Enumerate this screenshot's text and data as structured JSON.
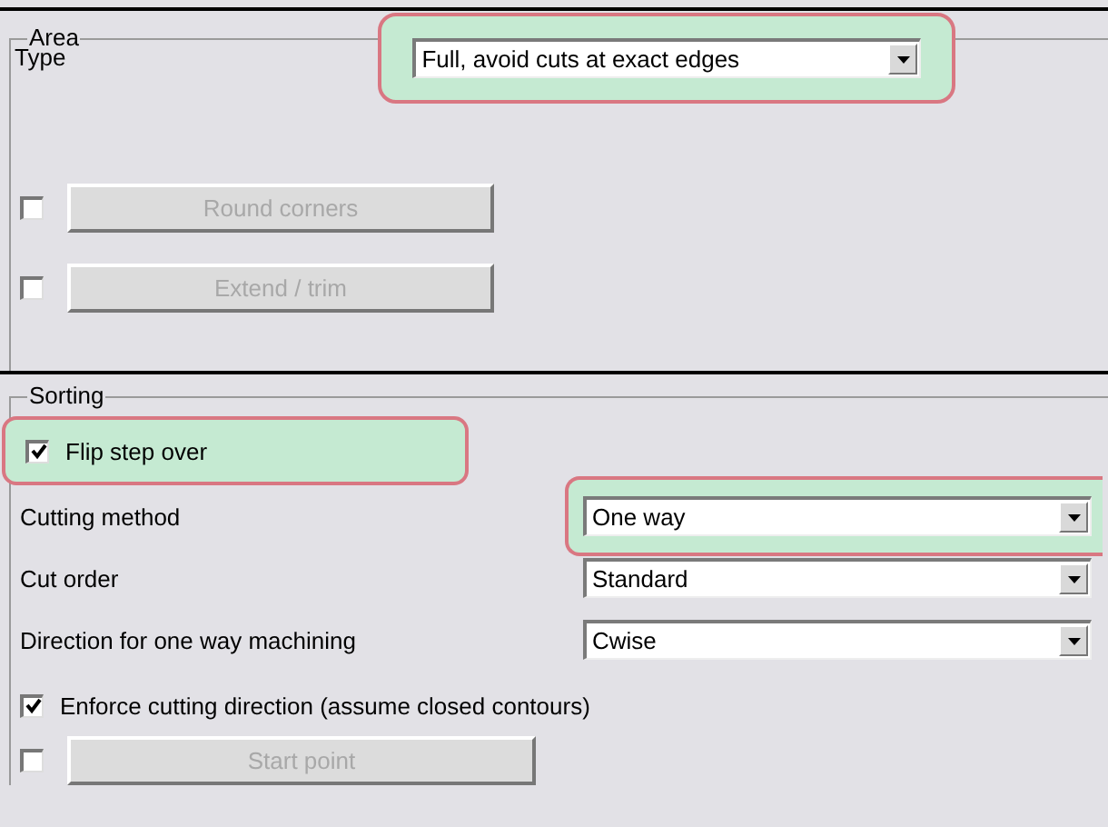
{
  "area": {
    "title": "Area",
    "type_label": "Type",
    "type_select": {
      "value": "Full, avoid cuts at exact edges",
      "highlighted": true
    },
    "options": [
      {
        "label": "Round corners",
        "checked": false,
        "disabled": true
      },
      {
        "label": "Extend / trim",
        "checked": false,
        "disabled": true
      }
    ]
  },
  "sorting": {
    "title": "Sorting",
    "flip": {
      "label": "Flip step over",
      "checked": true,
      "highlighted": true
    },
    "selects": [
      {
        "label": "Cutting method",
        "value": "One way",
        "highlighted": true
      },
      {
        "label": "Cut order",
        "value": "Standard",
        "highlighted": false
      },
      {
        "label": "Direction for one way machining",
        "value": "Cwise",
        "highlighted": false
      }
    ],
    "enforce": {
      "label": "Enforce cutting direction (assume closed contours)",
      "checked": true
    },
    "start_point": {
      "label": "Start point",
      "checked": false,
      "disabled": true
    }
  }
}
